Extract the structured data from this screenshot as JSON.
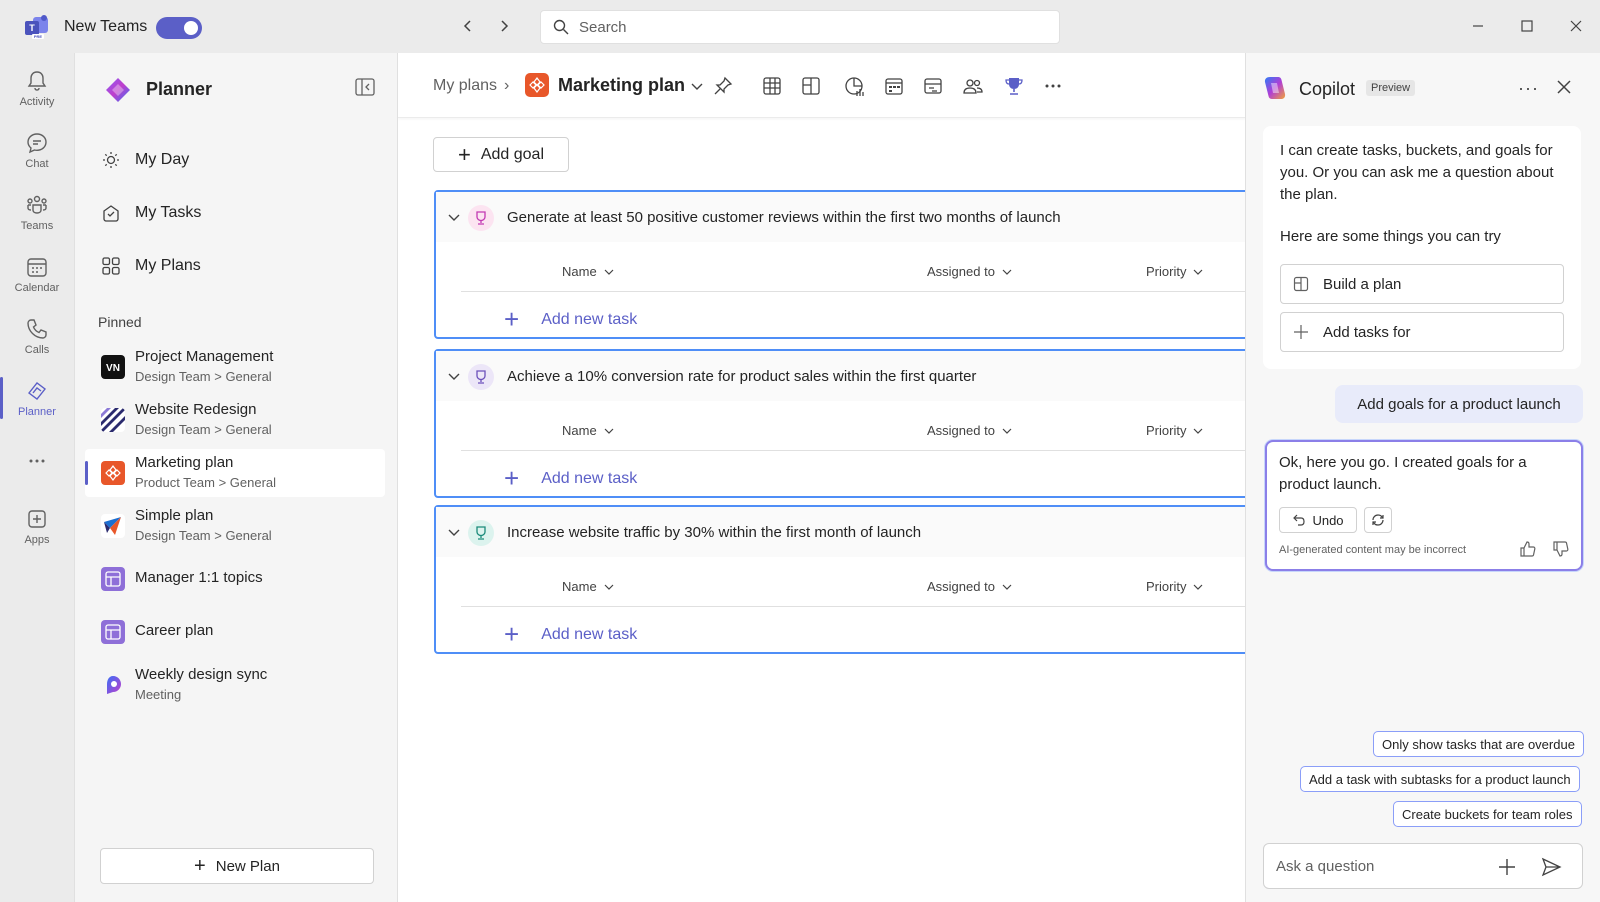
{
  "titlebar": {
    "app_title": "New Teams",
    "search_placeholder": "Search"
  },
  "rail": {
    "items": [
      {
        "label": "Activity",
        "icon": "bell-icon"
      },
      {
        "label": "Chat",
        "icon": "chat-icon"
      },
      {
        "label": "Teams",
        "icon": "teams-icon"
      },
      {
        "label": "Calendar",
        "icon": "calendar-icon"
      },
      {
        "label": "Calls",
        "icon": "phone-icon"
      },
      {
        "label": "Planner",
        "icon": "planner-icon",
        "active": true
      },
      {
        "label": "Apps",
        "icon": "apps-icon"
      }
    ]
  },
  "leftnav": {
    "title": "Planner",
    "items": [
      {
        "label": "My Day",
        "icon": "sun-icon"
      },
      {
        "label": "My Tasks",
        "icon": "tasks-icon"
      },
      {
        "label": "My Plans",
        "icon": "grid-icon"
      }
    ],
    "pinned_label": "Pinned",
    "pinned": [
      {
        "name": "Project Management",
        "sub": "Design Team > General",
        "icon_color": "#111111"
      },
      {
        "name": "Website Redesign",
        "sub": "Design Team > General",
        "icon_color": "#2b2b6e"
      },
      {
        "name": "Marketing plan",
        "sub": "Product Team > General",
        "icon_color": "#e8572a",
        "active": true
      },
      {
        "name": "Simple plan",
        "sub": "Design Team > General",
        "icon_color": "#1c6fd1"
      },
      {
        "name": "Manager 1:1 topics",
        "sub": "",
        "icon_color": "#8e6fd8"
      },
      {
        "name": "Career plan",
        "sub": "",
        "icon_color": "#8e6fd8"
      },
      {
        "name": "Weekly design sync",
        "sub": "Meeting",
        "icon_color": "#7b3fe4"
      }
    ],
    "new_plan_label": "New Plan"
  },
  "main": {
    "breadcrumb_root": "My plans",
    "plan_title": "Marketing plan",
    "add_goal_label": "Add goal",
    "columns": {
      "name": "Name",
      "assigned": "Assigned to",
      "priority": "Priority"
    },
    "add_task_label": "Add new task",
    "goals": [
      {
        "title": "Generate at least 50 positive customer reviews within the first two months of launch",
        "icon_bg": "#fce4f1",
        "icon_color": "#c239b3"
      },
      {
        "title": "Achieve a 10% conversion rate for product sales within the first quarter",
        "icon_bg": "#ece6f8",
        "icon_color": "#6b4fbb"
      },
      {
        "title": "Increase website traffic by 30% within the first month of launch",
        "icon_bg": "#dcf3ee",
        "icon_color": "#1a8a7a"
      }
    ]
  },
  "copilot": {
    "title": "Copilot",
    "badge": "Preview",
    "intro": "I can create tasks, buckets, and goals for you. Or you can ask me a question about the plan.",
    "try_label": "Here are some things you can try",
    "suggestions": [
      "Build a plan",
      "Add tasks for"
    ],
    "user_message": "Add goals for a product launch",
    "response": "Ok, here you go. I created goals for a product launch.",
    "undo_label": "Undo",
    "ai_note": "AI-generated content may be incorrect",
    "chips": [
      "Only show tasks that are overdue",
      "Add a task with subtasks for a product launch",
      "Create buckets for team roles"
    ],
    "ask_placeholder": "Ask a question"
  },
  "colors": {
    "accent": "#5b5fc7",
    "goal_border": "#4f8ef7",
    "plan_orange": "#e8572a"
  }
}
